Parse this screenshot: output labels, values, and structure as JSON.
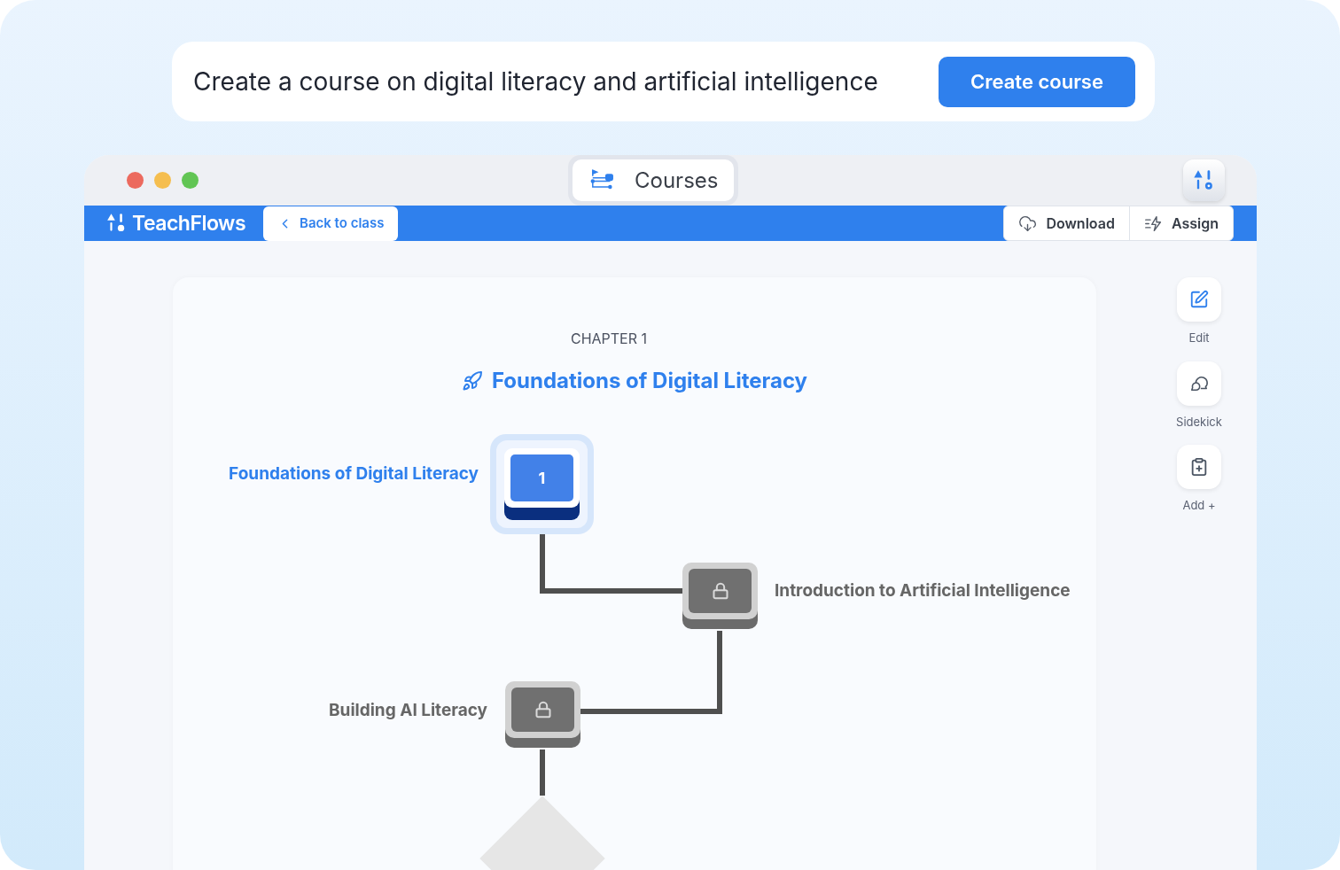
{
  "prompt": {
    "text": "Create a course on digital literacy and artificial intelligence",
    "button": "Create course"
  },
  "window": {
    "title": "Courses"
  },
  "app_bar": {
    "brand": "TeachFlows",
    "back_button": "Back to class",
    "actions": [
      {
        "label": "Download",
        "kind": "download"
      },
      {
        "label": "Assign",
        "kind": "assign"
      }
    ]
  },
  "chapter": {
    "label": "CHAPTER 1",
    "title": "Foundations of Digital Literacy"
  },
  "lessons": [
    {
      "title": "Foundations of Digital Literacy",
      "number": "1",
      "locked": false
    },
    {
      "title": "Introduction to Artificial Intelligence",
      "locked": true
    },
    {
      "title": "Building AI Literacy",
      "locked": true
    }
  ],
  "side_actions": [
    {
      "label": "Edit",
      "kind": "edit"
    },
    {
      "label": "Sidekick",
      "kind": "sidekick"
    },
    {
      "label": "Add +",
      "kind": "add"
    }
  ]
}
